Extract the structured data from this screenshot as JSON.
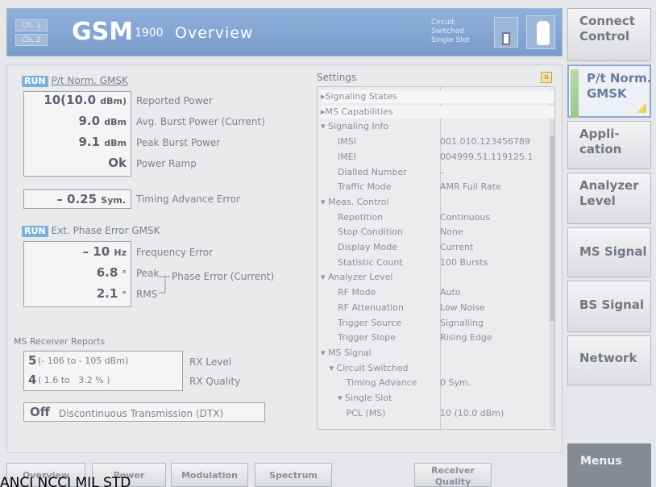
{
  "header": {
    "channels": [
      "Ch. 1",
      "Ch. 2"
    ],
    "title_main": "GSM",
    "title_band": "1900",
    "title_view": "Overview",
    "mode_lines": [
      "Circuit",
      "Switched",
      "Single Slot"
    ]
  },
  "softkeys": [
    {
      "label": "Connect\nControl"
    },
    {
      "label": "P/t Norm.\nGMSK",
      "active": true
    },
    {
      "label": "Appli-\ncation"
    },
    {
      "label": "Analyzer\nLevel"
    },
    {
      "label": "MS Signal"
    },
    {
      "label": "BS Signal"
    },
    {
      "label": "Network"
    }
  ],
  "menus_label": "Menus",
  "run_label": "RUN",
  "ptnorm": {
    "title": "P/t Norm. GMSK",
    "rows": [
      {
        "value": "10(10.0 ",
        "unit": "dBm)",
        "label": "Reported Power"
      },
      {
        "value": "9.0 ",
        "unit": "dBm",
        "label": "Avg. Burst Power (Current)"
      },
      {
        "value": "9.1 ",
        "unit": "dBm",
        "label": "Peak Burst Power"
      },
      {
        "value": "Ok",
        "unit": "",
        "label": "Power Ramp"
      }
    ],
    "timing": {
      "value": "– 0.25 ",
      "unit": "Sym.",
      "label": "Timing Advance Error"
    }
  },
  "phase": {
    "title": "Ext. Phase Error GMSK",
    "freq": {
      "value": "– 10 ",
      "unit": "Hz",
      "label": "Frequency Error"
    },
    "peak": {
      "value": "6.8 ",
      "unit": "°",
      "label": "Peak"
    },
    "rms": {
      "value": "2.1 ",
      "unit": "°",
      "label": "RMS"
    },
    "phase_label": "Phase Error (Current)"
  },
  "receiver": {
    "title": "MS Receiver Reports",
    "rx_level": {
      "value": "5",
      "range": "(- 106 to - 105 dBm)",
      "label": "RX Level"
    },
    "rx_quality": {
      "value": "4",
      "range": "( 1.6 to   3.2 % )",
      "label": "RX Quality"
    },
    "dtx": {
      "value": "Off",
      "label": "Discontinuous Transmission (DTX)"
    }
  },
  "settings": {
    "title": "Settings",
    "rows": [
      {
        "key": "▸Signaling States",
        "value": ""
      },
      {
        "key": "▸MS Capabilities",
        "value": ""
      },
      {
        "key": "▾ Signaling Info",
        "value": ""
      },
      {
        "key": "      IMSI",
        "value": "001.010.123456789"
      },
      {
        "key": "      IMEI",
        "value": "004999.51.119125.1"
      },
      {
        "key": "      Dialled Number",
        "value": "–"
      },
      {
        "key": "      Traffic Mode",
        "value": "AMR Full Rate"
      },
      {
        "key": "▾ Meas. Control",
        "value": ""
      },
      {
        "key": "      Repetition",
        "value": "Continuous"
      },
      {
        "key": "      Stop Condition",
        "value": "None"
      },
      {
        "key": "      Display Mode",
        "value": "Current"
      },
      {
        "key": "      Statistic Count",
        "value": "100  Bursts"
      },
      {
        "key": "▾ Analyzer Level",
        "value": ""
      },
      {
        "key": "      RF Mode",
        "value": "Auto"
      },
      {
        "key": "      RF Attenuation",
        "value": "Low Noise"
      },
      {
        "key": "      Trigger Source",
        "value": "Signalling"
      },
      {
        "key": "      Trigger Slope",
        "value": "Rising Edge"
      },
      {
        "key": "▾ MS Signal",
        "value": ""
      },
      {
        "key": "   ▾ Circuit Switched",
        "value": ""
      },
      {
        "key": "         Timing Advance",
        "value": "0  Sym."
      },
      {
        "key": "      ▾ Single Slot",
        "value": ""
      },
      {
        "key": "         PCL (MS)",
        "value": "10  (10.0 dBm)"
      }
    ]
  },
  "tabs": [
    "Overview",
    "Power",
    "Modulation",
    "Spectrum",
    "Receiver\nQuality"
  ],
  "stray_text": "ANCI NCCI MIL STD"
}
